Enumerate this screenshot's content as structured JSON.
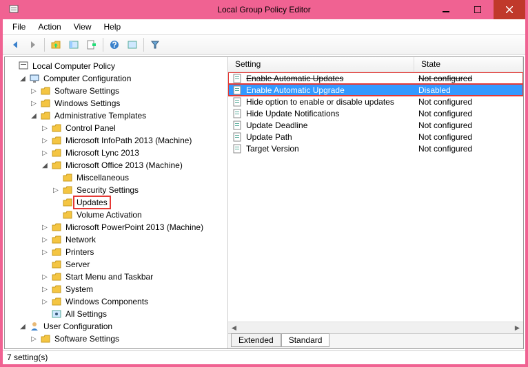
{
  "window": {
    "title": "Local Group Policy Editor"
  },
  "menu": {
    "file": "File",
    "action": "Action",
    "view": "View",
    "help": "Help"
  },
  "tree": {
    "root": "Local Computer Policy",
    "comp_config": "Computer Configuration",
    "software": "Software Settings",
    "windows": "Windows Settings",
    "admin": "Administrative Templates",
    "control_panel": "Control Panel",
    "infopath": "Microsoft InfoPath 2013 (Machine)",
    "lync": "Microsoft Lync 2013",
    "office": "Microsoft Office 2013 (Machine)",
    "misc": "Miscellaneous",
    "security": "Security Settings",
    "updates": "Updates",
    "volume": "Volume Activation",
    "ppt": "Microsoft PowerPoint 2013 (Machine)",
    "network": "Network",
    "printers": "Printers",
    "server": "Server",
    "startmenu": "Start Menu and Taskbar",
    "system": "System",
    "win_comp": "Windows Components",
    "all_settings": "All Settings",
    "user_config": "User Configuration",
    "user_software": "Software Settings"
  },
  "list": {
    "header_setting": "Setting",
    "header_state": "State",
    "rows": [
      {
        "name": "Enable Automatic Updates",
        "state": "Not configured"
      },
      {
        "name": "Enable Automatic Upgrade",
        "state": "Disabled"
      },
      {
        "name": "Hide option to enable or disable updates",
        "state": "Not configured"
      },
      {
        "name": "Hide Update Notifications",
        "state": "Not configured"
      },
      {
        "name": "Update Deadline",
        "state": "Not configured"
      },
      {
        "name": "Update Path",
        "state": "Not configured"
      },
      {
        "name": "Target Version",
        "state": "Not configured"
      }
    ]
  },
  "tabs": {
    "extended": "Extended",
    "standard": "Standard"
  },
  "status": "7 setting(s)"
}
